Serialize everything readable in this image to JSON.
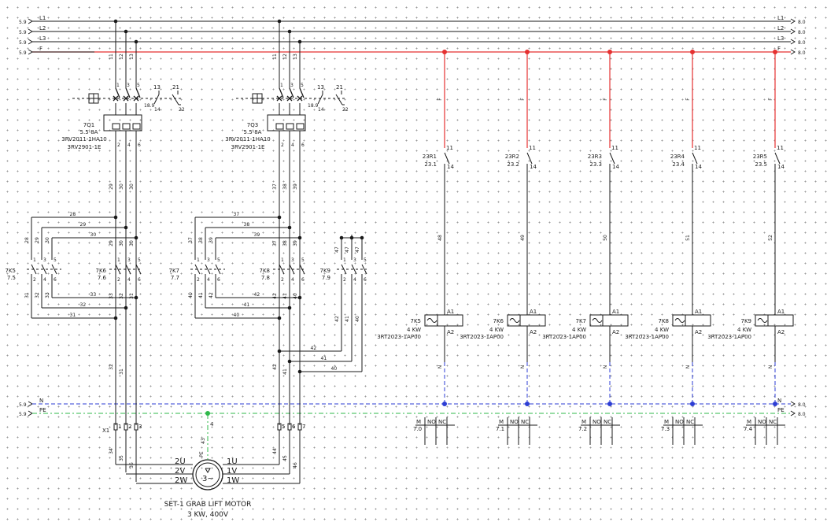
{
  "buses": [
    {
      "label": "L1",
      "ref_left": "5.9",
      "ref_right": "8.0"
    },
    {
      "label": "L2",
      "ref_left": "5.9",
      "ref_right": "8.0"
    },
    {
      "label": "L3",
      "ref_left": "5.9",
      "ref_right": "8.0"
    },
    {
      "label": "F",
      "ref_left": "5.9",
      "ref_right": "8.0"
    },
    {
      "label": "N",
      "ref_left": "5.9",
      "ref_right": "8.0"
    },
    {
      "label": "PE",
      "ref_left": "5.9",
      "ref_right": "8.0"
    }
  ],
  "breakers": [
    {
      "tag": "7Q1",
      "range": "5.5-8A",
      "part": "3RV2011-1HA10",
      "aux": "3RV2901-1E",
      "pins_top": [
        "1",
        "3",
        "5"
      ],
      "pins_bot": [
        "2",
        "4",
        "6"
      ],
      "aux_a": [
        "13",
        "14"
      ],
      "aux_b": [
        "21",
        "22"
      ],
      "aux_ref": "18.9"
    },
    {
      "tag": "7Q3",
      "range": "5.5-8A",
      "part": "3RV2011-1HA10",
      "aux": "3RV2901-1E",
      "pins_top": [
        "1",
        "3",
        "5"
      ],
      "pins_bot": [
        "2",
        "4",
        "6"
      ],
      "aux_a": [
        "13",
        "14"
      ],
      "aux_b": [
        "21",
        "22"
      ],
      "aux_ref": "18.9"
    }
  ],
  "contactors": [
    {
      "tag": "7K5",
      "ref": "7.5"
    },
    {
      "tag": "7K6",
      "ref": "7.6"
    },
    {
      "tag": "7K7",
      "ref": "7.7"
    },
    {
      "tag": "7K8",
      "ref": "7.8"
    },
    {
      "tag": "7K9",
      "ref": "7.9"
    }
  ],
  "contactor_pins": {
    "top": [
      "1",
      "3",
      "5"
    ],
    "bot": [
      "2",
      "4",
      "6"
    ]
  },
  "wires_left": {
    "phase_top": [
      "11",
      "12",
      "13"
    ],
    "below_breaker": [
      "29",
      "30",
      "30"
    ],
    "loop": [
      "28",
      "29",
      "30",
      "33",
      "32",
      "31"
    ],
    "vert_left": [
      "28",
      "29",
      "30"
    ],
    "vert_k5": [
      "31",
      "32",
      "33"
    ],
    "vert_k6": [
      "29",
      "30",
      "30"
    ],
    "vert_k6_bot": [
      "33",
      "32",
      "31"
    ],
    "drop": [
      "32",
      "31"
    ],
    "terminal_bot": [
      "34",
      "35",
      "36"
    ]
  },
  "wires_right": {
    "phase_top": [
      "11",
      "12",
      "13"
    ],
    "below_breaker": [
      "37",
      "38",
      "39"
    ],
    "loop": [
      "37",
      "38",
      "39",
      "42",
      "41",
      "40"
    ],
    "vert_left": [
      "37",
      "38",
      "39"
    ],
    "vert_k7": [
      "40",
      "41",
      "42"
    ],
    "vert_k8": [
      "37",
      "38",
      "39"
    ],
    "vert_k8_bot": [
      "42",
      "41",
      "40"
    ],
    "k9_top": [
      "47",
      "47",
      "47"
    ],
    "k9_bot": [
      "42",
      "41",
      "40"
    ],
    "h_bus": [
      "42",
      "41",
      "40"
    ],
    "drop": [
      "42",
      "41"
    ],
    "terminal_bot": [
      "44",
      "45",
      "46"
    ]
  },
  "terminal_strip": {
    "tag": "X1",
    "pins": [
      "1",
      "2",
      "3",
      "5",
      "6",
      "7"
    ]
  },
  "motor": {
    "title": "SET-1 GRAB LIFT MOTOR",
    "rating": "3 KW, 400V",
    "pe_label": "PE",
    "pe_pin": "4",
    "pe_wire": "43",
    "left_terms": [
      "2U",
      "2V",
      "2W"
    ],
    "right_terms": [
      "1U",
      "1V",
      "1W"
    ],
    "left_wires": [
      "34",
      "35",
      "36"
    ],
    "right_wires": [
      "44",
      "45",
      "46"
    ],
    "symbol": "3~"
  },
  "control_circuits": [
    {
      "relay": "23R1",
      "ref": "23.1",
      "contact_top": "11",
      "contact_bot": "14",
      "fuse_wire": "F",
      "wire": "48",
      "coil": "7K5",
      "power": "4 KW",
      "part": "3RT2023-1AP00",
      "a1": "A1",
      "a2": "A2",
      "neutral": "N",
      "term_labels": [
        "M",
        "NO",
        "NC"
      ],
      "term_ref": "7.0"
    },
    {
      "relay": "23R2",
      "ref": "23.2",
      "contact_top": "11",
      "contact_bot": "14",
      "fuse_wire": "F",
      "wire": "49",
      "coil": "7K6",
      "power": "4 KW",
      "part": "3RT2023-1AP00",
      "a1": "A1",
      "a2": "A2",
      "neutral": "N",
      "term_labels": [
        "M",
        "NO",
        "NC"
      ],
      "term_ref": "7.1"
    },
    {
      "relay": "23R3",
      "ref": "23.3",
      "contact_top": "11",
      "contact_bot": "14",
      "fuse_wire": "F",
      "wire": "50",
      "coil": "7K7",
      "power": "4 KW",
      "part": "3RT2023-1AP00",
      "a1": "A1",
      "a2": "A2",
      "neutral": "N",
      "term_labels": [
        "M",
        "NO",
        "NC"
      ],
      "term_ref": "7.2"
    },
    {
      "relay": "23R4",
      "ref": "23.4",
      "contact_top": "11",
      "contact_bot": "14",
      "fuse_wire": "F",
      "wire": "51",
      "coil": "7K8",
      "power": "4 KW",
      "part": "3RT2023-1AP00",
      "a1": "A1",
      "a2": "A2",
      "neutral": "N",
      "term_labels": [
        "M",
        "NO",
        "NC"
      ],
      "term_ref": "7.3"
    },
    {
      "relay": "23R5",
      "ref": "23.5",
      "contact_top": "11",
      "contact_bot": "14",
      "fuse_wire": "F",
      "wire": "52",
      "coil": "7K9",
      "power": "4 KW",
      "part": "3RT2023-1AP00",
      "a1": "A1",
      "a2": "A2",
      "neutral": "N",
      "term_labels": [
        "M",
        "NO",
        "NC"
      ],
      "term_ref": "7.4"
    }
  ],
  "colors": {
    "wire": "#1a1a1a",
    "fuse_bus": "#e53030",
    "neutral": "#2d3ed4",
    "pe": "#2fb84a",
    "grid": "#9a9a9a"
  }
}
